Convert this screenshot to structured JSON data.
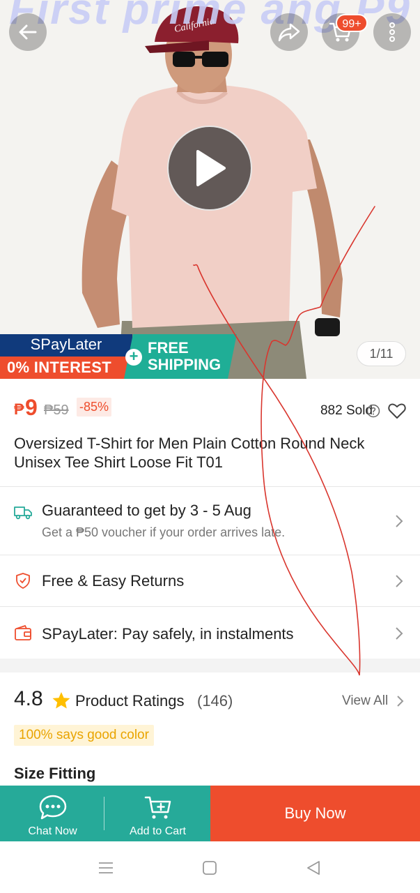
{
  "hero": {
    "watermark_text": "First prime ang P9",
    "cart_badge": "99+",
    "page_indicator": "1/11",
    "promo": {
      "spaylater_label": "SPayLater",
      "interest_label": "0% INTEREST",
      "free_line1": "FREE",
      "free_line2": "SHIPPING"
    },
    "figure_cap_text": "California"
  },
  "price": {
    "currency": "₱",
    "current": "9",
    "original": "₱59",
    "discount": "-85%",
    "sold": "882 Sold"
  },
  "product": {
    "title": "Oversized T-Shirt for Men Plain Cotton Round Neck Unisex Tee Shirt Loose Fit T01"
  },
  "delivery": {
    "title": "Guaranteed to get by 3 - 5 Aug",
    "subtitle": "Get a ₱50 voucher if your order arrives late."
  },
  "returns": {
    "title": "Free & Easy Returns"
  },
  "spaylater": {
    "title": "SPayLater: Pay safely, in instalments"
  },
  "ratings": {
    "value": "4.8",
    "label": "Product Ratings",
    "count": "(146)",
    "view_all": "View All",
    "tag": "100% says good color"
  },
  "size_fitting": {
    "label": "Size Fitting"
  },
  "bottom_bar": {
    "chat_label": "Chat Now",
    "cart_label": "Add to Cart",
    "buy_label": "Buy Now"
  },
  "colors": {
    "brand_orange": "#ee4d2d",
    "teal": "#26aa99",
    "navy": "#103a7c",
    "tag_yellow": "#e9a400"
  }
}
